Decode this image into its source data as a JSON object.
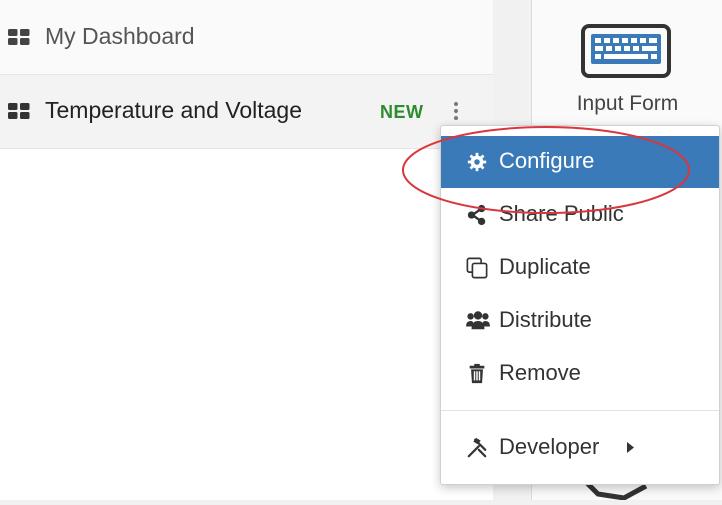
{
  "dashboards": [
    {
      "label": "My Dashboard"
    },
    {
      "label": "Temperature and Voltage",
      "badge": "NEW"
    }
  ],
  "side_panel": {
    "widget_label": "Input Form",
    "widget_icon": "keyboard-icon"
  },
  "context_menu": {
    "items": [
      {
        "label": "Configure",
        "icon": "gear-icon",
        "active": true
      },
      {
        "label": "Share Public",
        "icon": "share-icon"
      },
      {
        "label": "Duplicate",
        "icon": "copy-icon"
      },
      {
        "label": "Distribute",
        "icon": "users-icon"
      },
      {
        "label": "Remove",
        "icon": "trash-icon"
      },
      {
        "label": "Developer",
        "icon": "tools-icon",
        "submenu": true
      }
    ]
  },
  "colors": {
    "menu_active_bg": "#3a7ab8",
    "badge_new": "#2e8b2e",
    "highlight_ellipse": "#d9363e"
  }
}
